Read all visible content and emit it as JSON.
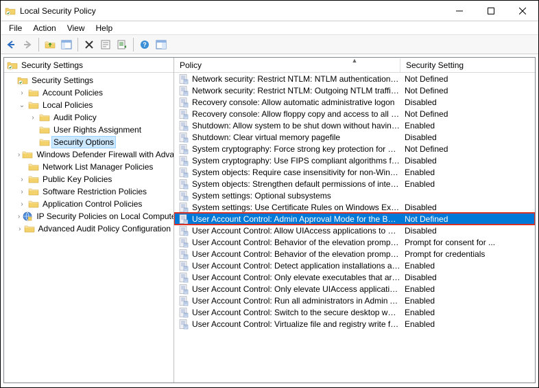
{
  "window": {
    "title": "Local Security Policy"
  },
  "menus": [
    "File",
    "Action",
    "View",
    "Help"
  ],
  "left_header": "Security Settings",
  "right_header": {
    "policy": "Policy",
    "setting": "Security Setting"
  },
  "tree": [
    {
      "depth": 0,
      "icon": "root",
      "label": "Security Settings",
      "twisty": ""
    },
    {
      "depth": 1,
      "icon": "folder",
      "label": "Account Policies",
      "twisty": ">"
    },
    {
      "depth": 1,
      "icon": "folder",
      "label": "Local Policies",
      "twisty": "v"
    },
    {
      "depth": 2,
      "icon": "folder",
      "label": "Audit Policy",
      "twisty": ">"
    },
    {
      "depth": 2,
      "icon": "folder",
      "label": "User Rights Assignment",
      "twisty": ""
    },
    {
      "depth": 2,
      "icon": "folder",
      "label": "Security Options",
      "twisty": "",
      "selected": true
    },
    {
      "depth": 1,
      "icon": "folder",
      "label": "Windows Defender Firewall with Adva",
      "twisty": ">"
    },
    {
      "depth": 1,
      "icon": "folder",
      "label": "Network List Manager Policies",
      "twisty": ""
    },
    {
      "depth": 1,
      "icon": "folder",
      "label": "Public Key Policies",
      "twisty": ">"
    },
    {
      "depth": 1,
      "icon": "folder",
      "label": "Software Restriction Policies",
      "twisty": ">"
    },
    {
      "depth": 1,
      "icon": "folder",
      "label": "Application Control Policies",
      "twisty": ">"
    },
    {
      "depth": 1,
      "icon": "ipsec",
      "label": "IP Security Policies on Local Compute",
      "twisty": ">"
    },
    {
      "depth": 1,
      "icon": "folder",
      "label": "Advanced Audit Policy Configuration",
      "twisty": ">"
    }
  ],
  "policies": [
    {
      "name": "Network security: Restrict NTLM: NTLM authentication in thi...",
      "setting": "Not Defined"
    },
    {
      "name": "Network security: Restrict NTLM: Outgoing NTLM traffic to r...",
      "setting": "Not Defined"
    },
    {
      "name": "Recovery console: Allow automatic administrative logon",
      "setting": "Disabled"
    },
    {
      "name": "Recovery console: Allow floppy copy and access to all drives...",
      "setting": "Not Defined"
    },
    {
      "name": "Shutdown: Allow system to be shut down without having to...",
      "setting": "Enabled"
    },
    {
      "name": "Shutdown: Clear virtual memory pagefile",
      "setting": "Disabled"
    },
    {
      "name": "System cryptography: Force strong key protection for user k...",
      "setting": "Not Defined"
    },
    {
      "name": "System cryptography: Use FIPS compliant algorithms for en...",
      "setting": "Disabled"
    },
    {
      "name": "System objects: Require case insensitivity for non-Windows ...",
      "setting": "Enabled"
    },
    {
      "name": "System objects: Strengthen default permissions of internal s...",
      "setting": "Enabled"
    },
    {
      "name": "System settings: Optional subsystems",
      "setting": ""
    },
    {
      "name": "System settings: Use Certificate Rules on Windows Executab...",
      "setting": "Disabled"
    },
    {
      "name": "User Account Control: Admin Approval Mode for the Built-i...",
      "setting": "Not Defined",
      "selected": true
    },
    {
      "name": "User Account Control: Allow UIAccess applications to prom...",
      "setting": "Disabled"
    },
    {
      "name": "User Account Control: Behavior of the elevation prompt for ...",
      "setting": "Prompt for consent for ..."
    },
    {
      "name": "User Account Control: Behavior of the elevation prompt for ...",
      "setting": "Prompt for credentials"
    },
    {
      "name": "User Account Control: Detect application installations and p...",
      "setting": "Enabled"
    },
    {
      "name": "User Account Control: Only elevate executables that are sig...",
      "setting": "Disabled"
    },
    {
      "name": "User Account Control: Only elevate UIAccess applications th...",
      "setting": "Enabled"
    },
    {
      "name": "User Account Control: Run all administrators in Admin Appr...",
      "setting": "Enabled"
    },
    {
      "name": "User Account Control: Switch to the secure desktop when pr...",
      "setting": "Enabled"
    },
    {
      "name": "User Account Control: Virtualize file and registry write failure...",
      "setting": "Enabled"
    }
  ]
}
